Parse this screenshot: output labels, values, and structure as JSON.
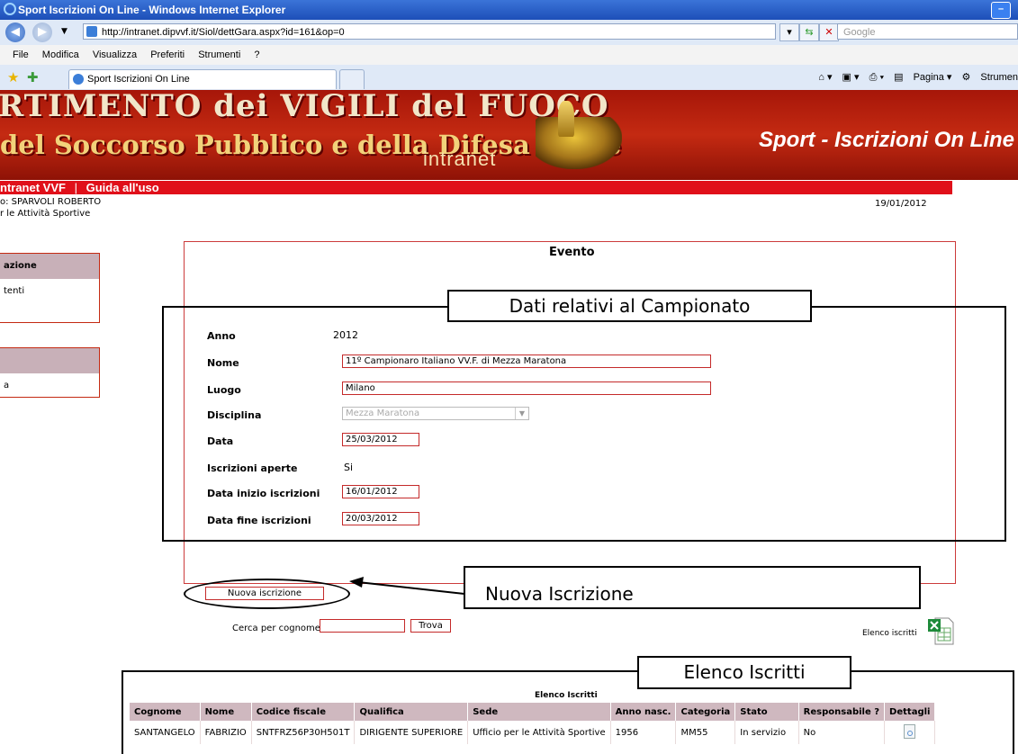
{
  "browser": {
    "window_title": "Sport Iscrizioni On Line - Windows Internet Explorer",
    "url": "http://intranet.dipvvf.it/Siol/dettGara.aspx?id=161&op=0",
    "search_placeholder": "Google",
    "menu": [
      "File",
      "Modifica",
      "Visualizza",
      "Preferiti",
      "Strumenti",
      "?"
    ],
    "tab_label": "Sport Iscrizioni On Line",
    "toolbar_right": {
      "pagina": "Pagina",
      "strumenti": "Strumen"
    }
  },
  "banner": {
    "line1": "RTIMENTO dei VIGILI del FUOCO",
    "line2": "del Soccorso Pubblico e della Difesa Civile",
    "intranet": "intranet",
    "app_title": "Sport - Iscrizioni On Line"
  },
  "nav": {
    "links": [
      "ntranet VVF",
      "Guida all'uso"
    ],
    "separator": "|",
    "user": "o: SPARVOLI ROBERTO",
    "office": "r le Attività Sportive",
    "date": "19/01/2012"
  },
  "sidebar": {
    "box1": {
      "header": "azione",
      "item": "tenti"
    },
    "box2": {
      "item": "a"
    }
  },
  "evento": {
    "title": "Evento",
    "fields": {
      "anno": {
        "label": "Anno",
        "value": "2012"
      },
      "nome": {
        "label": "Nome",
        "value": "11º Campionaro Italiano VV.F. di Mezza Maratona"
      },
      "luogo": {
        "label": "Luogo",
        "value": "Milano"
      },
      "disciplina": {
        "label": "Disciplina",
        "value": "Mezza Maratona"
      },
      "data": {
        "label": "Data",
        "value": "25/03/2012"
      },
      "iscrizioni_aperte": {
        "label": "Iscrizioni aperte",
        "value": "Si"
      },
      "data_inizio": {
        "label": "Data inizio iscrizioni",
        "value": "16/01/2012"
      },
      "data_fine": {
        "label": "Data fine iscrizioni",
        "value": "20/03/2012"
      }
    },
    "nuova_button": "Nuova iscrizione"
  },
  "annotations": {
    "dati_campionato": "Dati relativi al Campionato",
    "nuova_iscrizione": "Nuova Iscrizione",
    "elenco_iscritti": "Elenco Iscritti"
  },
  "search": {
    "label": "Cerca per cognome:",
    "button": "Trova",
    "export_link": "Elenco iscritti"
  },
  "table": {
    "title": "Elenco Iscritti",
    "headers": [
      "Cognome",
      "Nome",
      "Codice fiscale",
      "Qualifica",
      "Sede",
      "Anno nasc.",
      "Categoria",
      "Stato",
      "Responsabile ?",
      "Dettagli"
    ],
    "rows": [
      [
        "SANTANGELO",
        "FABRIZIO",
        "SNTFRZ56P30H501T",
        "DIRIGENTE SUPERIORE",
        "Ufficio per le Attività Sportive",
        "1956",
        "MM55",
        "In servizio",
        "No"
      ]
    ]
  }
}
